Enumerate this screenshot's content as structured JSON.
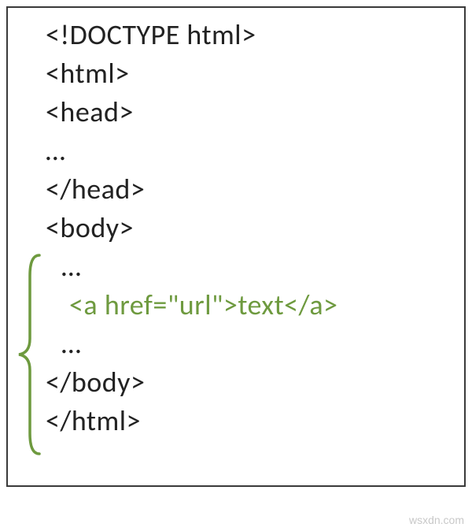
{
  "lines": {
    "l1": "<!DOCTYPE html>",
    "l2": "<html>",
    "l3": "<head>",
    "l4": "…",
    "l5": "</head>",
    "l6": "<body>",
    "l7": "…",
    "l8": "<a href=\"url\">text</a>",
    "l9": "…",
    "l10": "</body>",
    "l11": "</html>"
  },
  "watermark": "wsxdn.com"
}
